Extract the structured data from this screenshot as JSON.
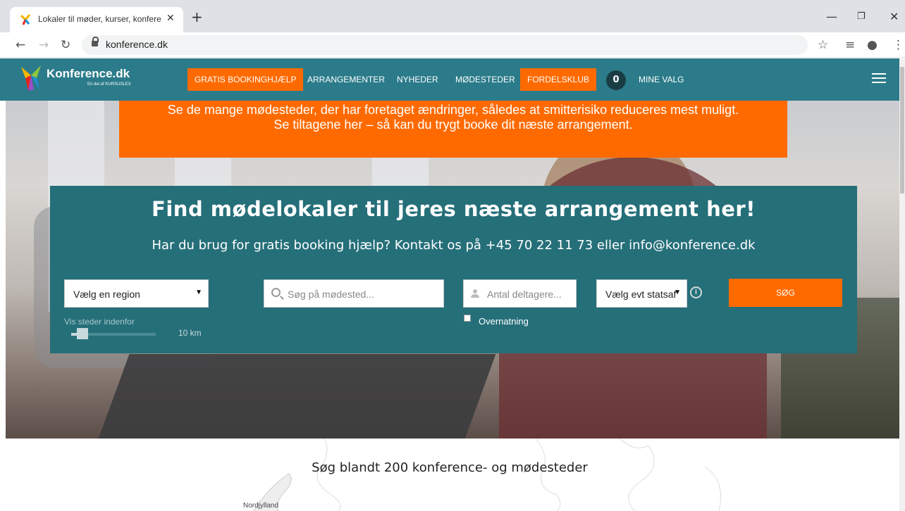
{
  "browser": {
    "tab_title": "Lokaler til møder, kurser, konfere",
    "new_tab": "+",
    "url": "konference.dk",
    "window_controls": [
      "minimize-icon",
      "restore-icon",
      "close-icon"
    ]
  },
  "site": {
    "logo_text": "Konference.dk",
    "logo_sub": "En del af KURSUSLEX",
    "nav": [
      {
        "label": "GRATIS BOOKINGHJÆLP",
        "highlight": true
      },
      {
        "label": "ARRANGEMENTER",
        "highlight": false
      },
      {
        "label": "NYHEDER",
        "highlight": false
      },
      {
        "label": "MØDESTEDER",
        "highlight": false
      },
      {
        "label": "FORDELSKLUB",
        "highlight": true
      }
    ],
    "cart_count": "0",
    "my_choices": "MINE VALG"
  },
  "notice": {
    "line1": "Se de mange mødesteder, der har foretaget ændringer, således at smitterisiko reduceres mest muligt.",
    "line2": "Se tiltagene her – så kan du trygt booke dit næste arrangement."
  },
  "search": {
    "title": "Find mødelokaler til jeres næste arrangement her!",
    "subtitle": "Har du brug for gratis booking hjælp? Kontakt os på +45 70 22 11 73 eller info@konference.dk",
    "region_value": "Vælg en region",
    "venue_placeholder": "Søg på mødested...",
    "participants_placeholder": "Antal deltagere...",
    "state_value": "Vælg evt statsaf",
    "submit_label": "SØG",
    "range_label": "Vis steder indenfor",
    "range_value": "10 km",
    "range_fraction": 0.1,
    "overnight_label": "Overnatning",
    "overnight_checked": false
  },
  "map": {
    "heading": "Søg blandt 200 konference- og mødesteder",
    "region_label": "Nordjylland"
  },
  "colors": {
    "teal_header": "#2b7b8a",
    "teal_panel": "#256f79",
    "orange": "#ff6a00"
  }
}
